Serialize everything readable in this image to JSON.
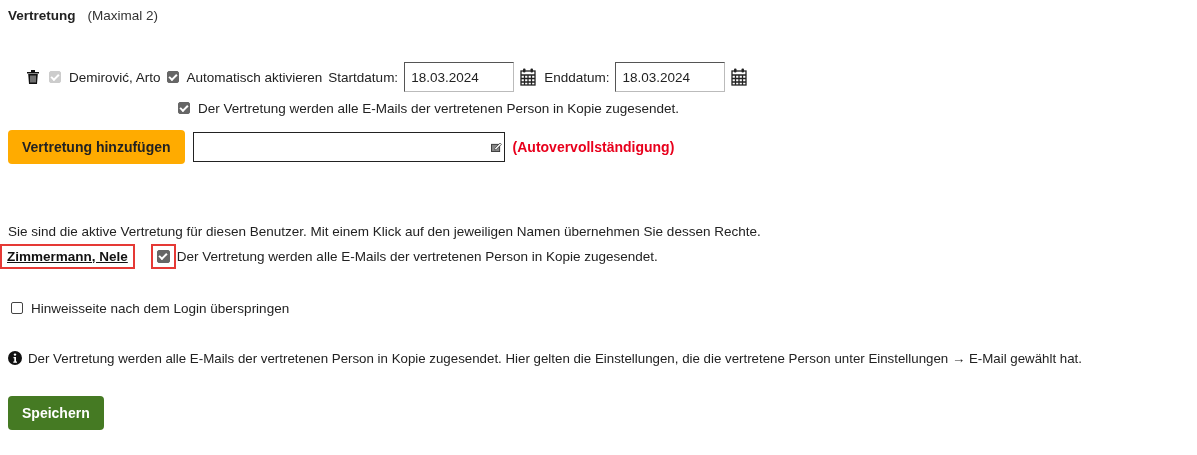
{
  "section": {
    "title": "Vertretung",
    "hint": "(Maximal 2)"
  },
  "substitutes": [
    {
      "name": "Demirović, Arto",
      "name_checked": true,
      "name_disabled": true,
      "auto_activate": {
        "label": "Automatisch aktivieren",
        "checked": true
      },
      "start_label": "Startdatum:",
      "start_value": "18.03.2024",
      "end_label": "Enddatum:",
      "end_value": "18.03.2024",
      "email_copy": {
        "label": "Der Vertretung werden alle E-Mails der vertretenen Person in Kopie zugesendet.",
        "checked": true
      }
    }
  ],
  "add_button": "Vertretung hinzufügen",
  "autocomplete_note": "(Autovervollständigung)",
  "active_info": "Sie sind die aktive Vertretung für diesen Benutzer. Mit einem Klick auf den jeweiligen Namen übernehmen Sie dessen Rechte.",
  "represented": [
    {
      "name": "Zimmermann, Nele",
      "highlighted": true,
      "email_copy": {
        "label": "Der Vertretung werden alle E-Mails der vertretenen Person in Kopie zugesendet.",
        "checked": true,
        "highlighted": true
      }
    }
  ],
  "skip_hint": {
    "label": "Hinweisseite nach dem Login überspringen",
    "checked": false
  },
  "info_note": "Der Vertretung werden alle E-Mails der vertretenen Person in Kopie zugesendet. Hier gelten die Einstellungen, die die vertretene Person unter Einstellungen → E-Mail gewählt hat.",
  "save_button": "Speichern"
}
